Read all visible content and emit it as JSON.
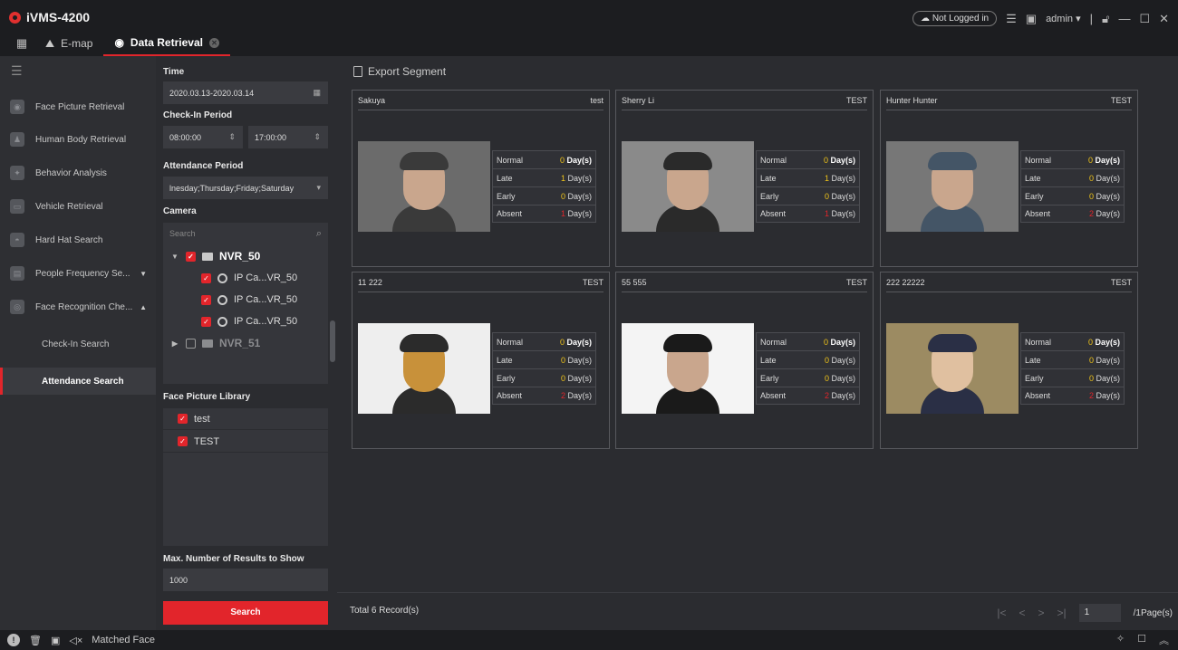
{
  "app": {
    "title": "iVMS-4200"
  },
  "tabs": [
    {
      "label": "E-map"
    },
    {
      "label": "Data Retrieval"
    }
  ],
  "topbar": {
    "login_status": "Not Logged in",
    "user": "admin"
  },
  "nav": {
    "items": [
      {
        "label": "Face Picture Retrieval"
      },
      {
        "label": "Human Body Retrieval"
      },
      {
        "label": "Behavior Analysis"
      },
      {
        "label": "Vehicle Retrieval"
      },
      {
        "label": "Hard Hat Search"
      },
      {
        "label": "People Frequency Se..."
      },
      {
        "label": "Face Recognition Che..."
      }
    ],
    "sub": [
      {
        "label": "Check-In Search"
      },
      {
        "label": "Attendance Search"
      }
    ]
  },
  "filter": {
    "time_label": "Time",
    "time_value": "2020.03.13-2020.03.14",
    "checkin_label": "Check-In Period",
    "checkin_start": "08:00:00",
    "checkin_end": "17:00:00",
    "attendance_label": "Attendance Period",
    "attendance_value": "lnesday;Thursday;Friday;Saturday",
    "camera_label": "Camera",
    "search_placeholder": "Search",
    "tree": [
      {
        "label": "NVR_50"
      },
      {
        "label": "IP Ca...VR_50"
      },
      {
        "label": "IP Ca...VR_50"
      },
      {
        "label": "IP Ca...VR_50"
      },
      {
        "label": "NVR_51"
      }
    ],
    "library_label": "Face Picture Library",
    "libraries": [
      {
        "label": "test"
      },
      {
        "label": "TEST"
      }
    ],
    "max_label": "Max. Number of Results to Show",
    "max_value": "1000",
    "search_button": "Search"
  },
  "main": {
    "export_label": "Export Segment",
    "stat_labels": {
      "normal": "Normal",
      "late": "Late",
      "early": "Early",
      "absent": "Absent",
      "unit": "Day(s)"
    },
    "cards": [
      {
        "name": "Sakuya",
        "group": "test",
        "normal": "0",
        "late": "1",
        "early": "0",
        "absent": "1"
      },
      {
        "name": "Sherry Li",
        "group": "TEST",
        "normal": "0",
        "late": "1",
        "early": "0",
        "absent": "1"
      },
      {
        "name": "Hunter Hunter",
        "group": "TEST",
        "normal": "0",
        "late": "0",
        "early": "0",
        "absent": "2"
      },
      {
        "name": "11 222",
        "group": "TEST",
        "normal": "0",
        "late": "0",
        "early": "0",
        "absent": "2"
      },
      {
        "name": "55 555",
        "group": "TEST",
        "normal": "0",
        "late": "0",
        "early": "0",
        "absent": "2"
      },
      {
        "name": "222 22222",
        "group": "TEST",
        "normal": "0",
        "late": "0",
        "early": "0",
        "absent": "2"
      }
    ],
    "total": "Total 6 Record(s)",
    "page": "1",
    "page_total": "/1Page(s)"
  },
  "statusbar": {
    "label": "Matched Face"
  },
  "colors": {
    "accent": "#e2252b",
    "background": "#2b2c30",
    "highlight": "#f0c419"
  }
}
